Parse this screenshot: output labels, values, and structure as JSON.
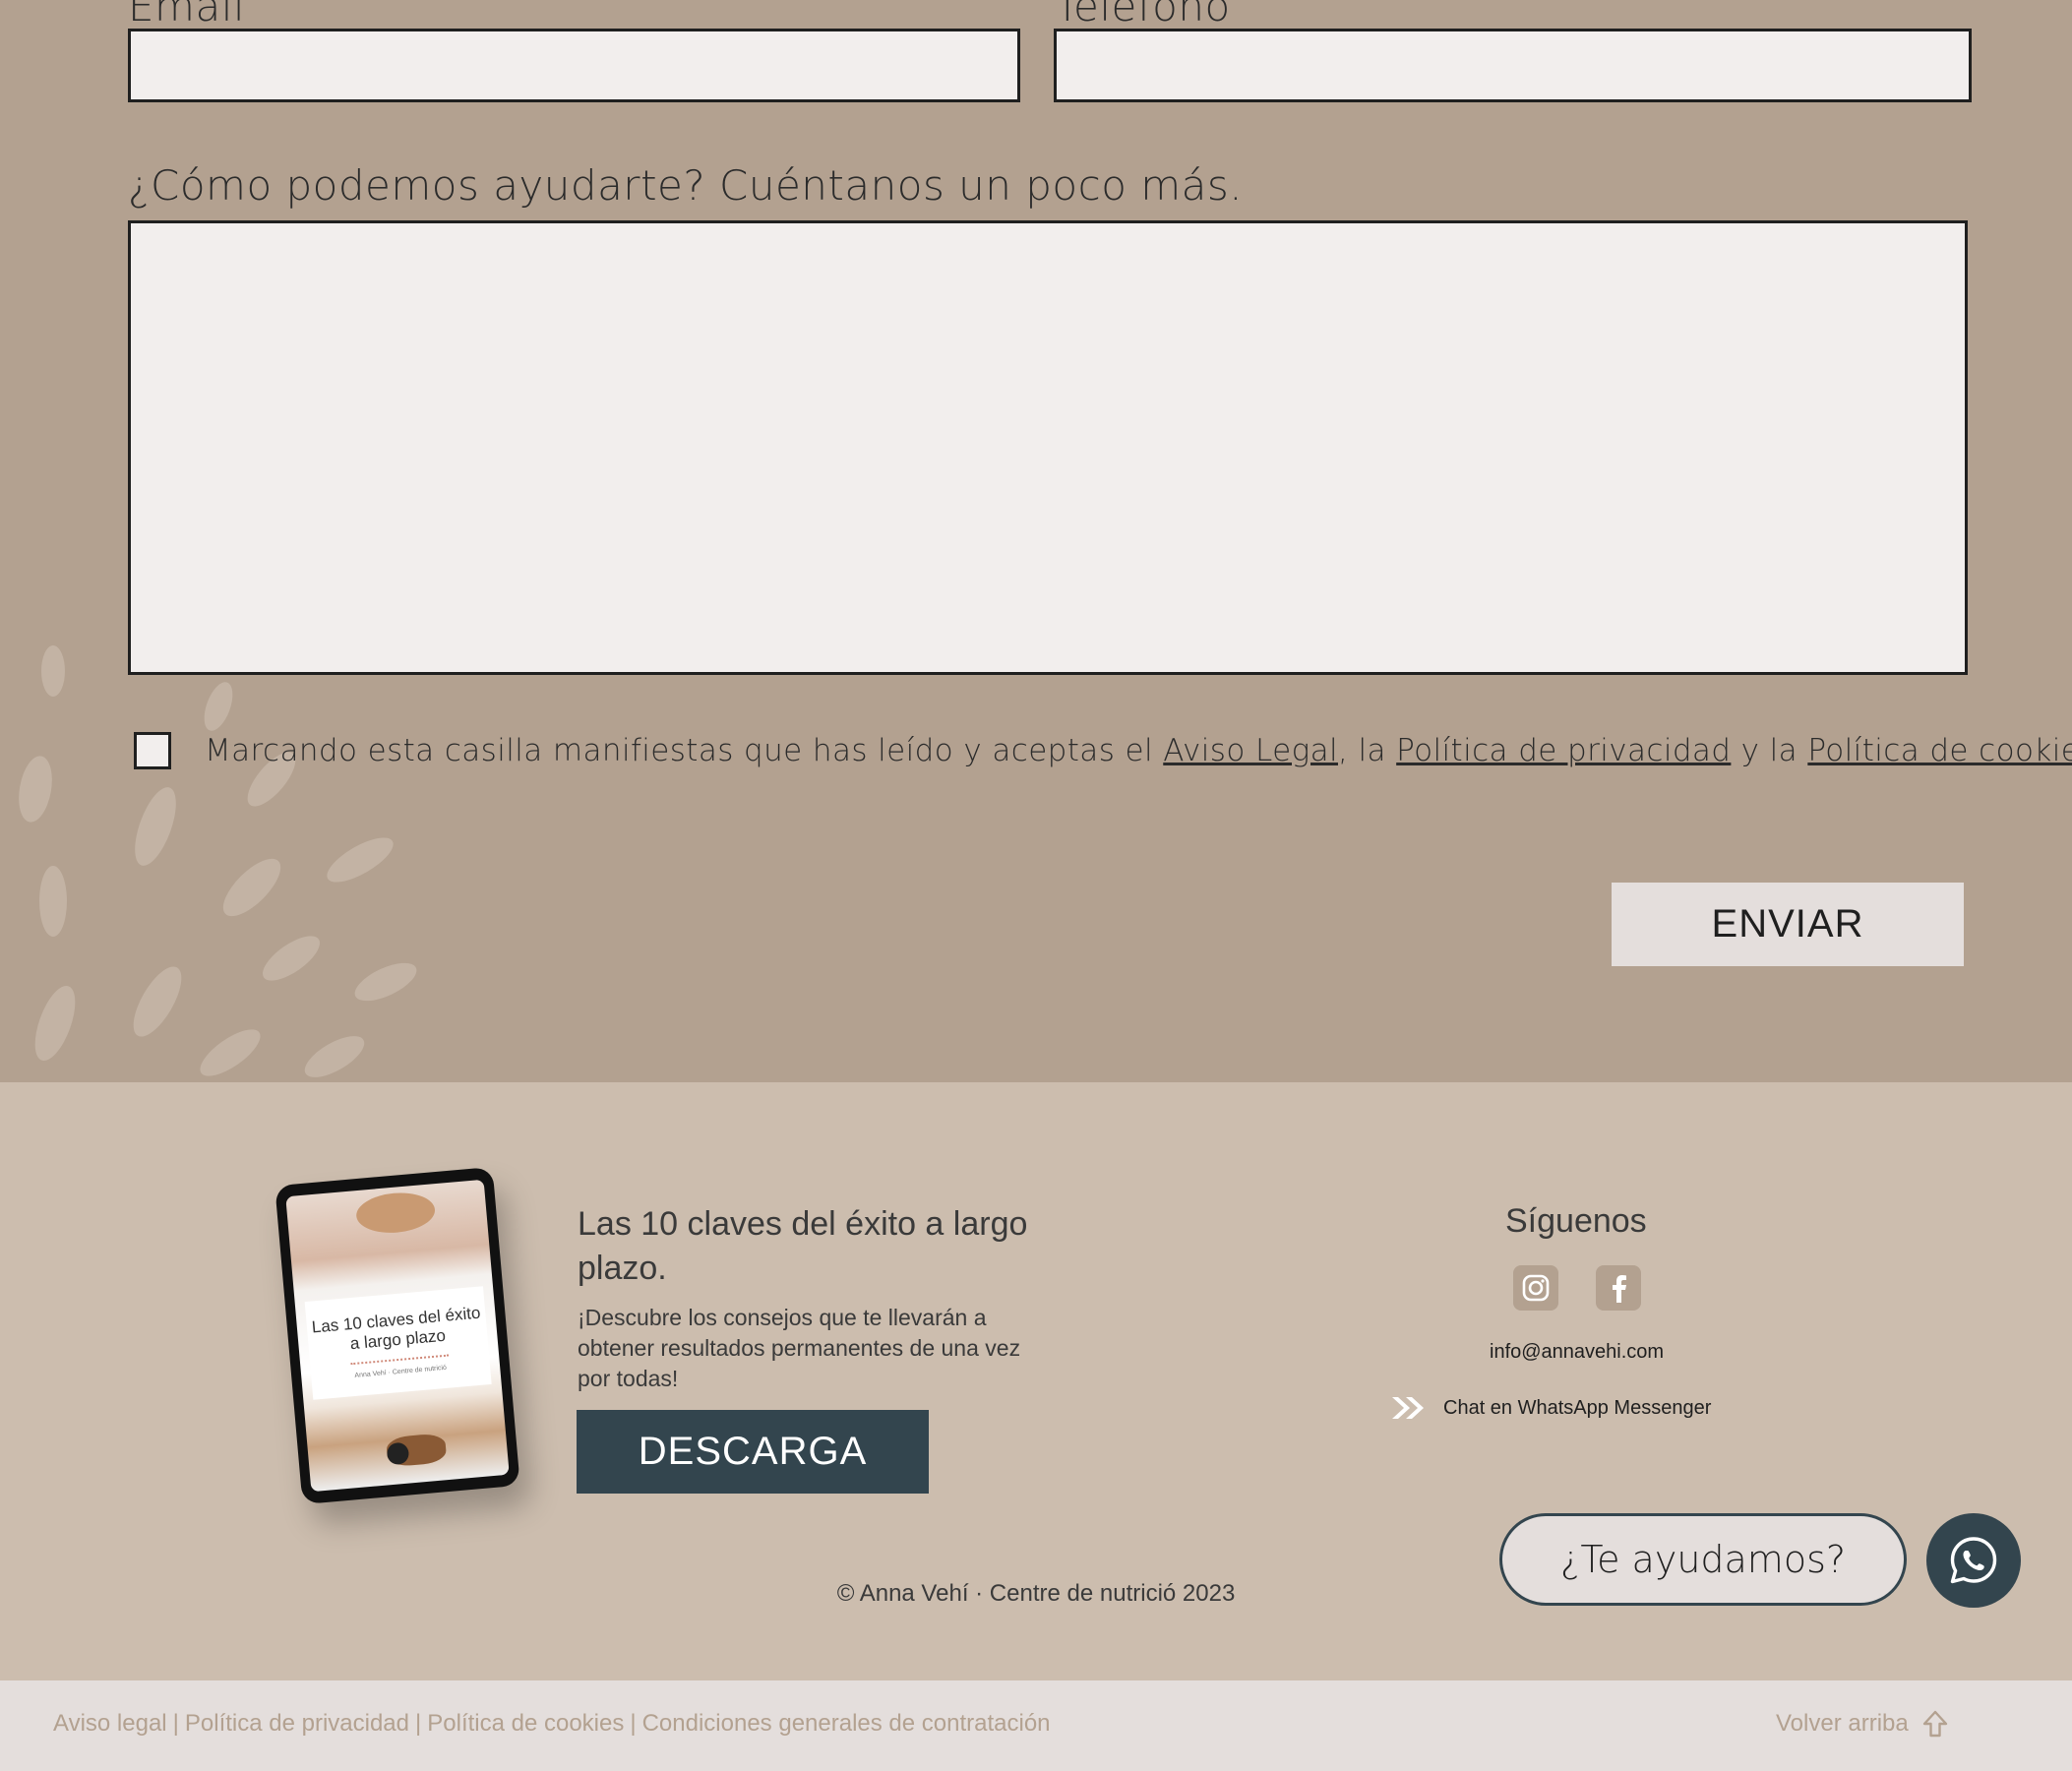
{
  "form": {
    "email_label": "Email",
    "phone_label": "Teléfono",
    "message_label": "¿Cómo podemos ayudarte? Cuéntanos un poco más.",
    "consent": {
      "prefix": "Marcando esta casilla manifiestas que has leído y aceptas el ",
      "link1": "Aviso Legal",
      "mid1": ", la ",
      "link2": "Política de privacidad",
      "mid2": " y la ",
      "link3": "Política de cookies",
      "suffix": "."
    },
    "submit_label": "ENVIAR"
  },
  "promo": {
    "tablet_title": "Las 10 claves del éxito a largo plazo",
    "tablet_sub": "Anna Vehí · Centre de nutrició",
    "title": "Las 10 claves del éxito a largo plazo.",
    "description": "¡Descubre los consejos que te llevarán a obtener resultados permanentes de una vez por todas!",
    "button_label": "DESCARGA"
  },
  "social": {
    "title": "Síguenos",
    "email": "info@annavehi.com",
    "whatsapp_label": "Chat en WhatsApp Messenger"
  },
  "help_bubble": "¿Te ayudamos?",
  "copyright": "© Anna Vehí · Centre de nutrició 2023",
  "bottom_bar": {
    "links": [
      "Aviso legal",
      "Política de privacidad",
      "Política de cookies",
      "Condiciones generales de contratación"
    ],
    "separator": "|",
    "back_to_top": "Volver arriba"
  },
  "colors": {
    "form_bg": "#b3a190",
    "footer_bg": "#ccbdae",
    "bottom_bar_bg": "#e4dedc",
    "dark_accent": "#33454e",
    "input_bg": "#f2eeed"
  }
}
